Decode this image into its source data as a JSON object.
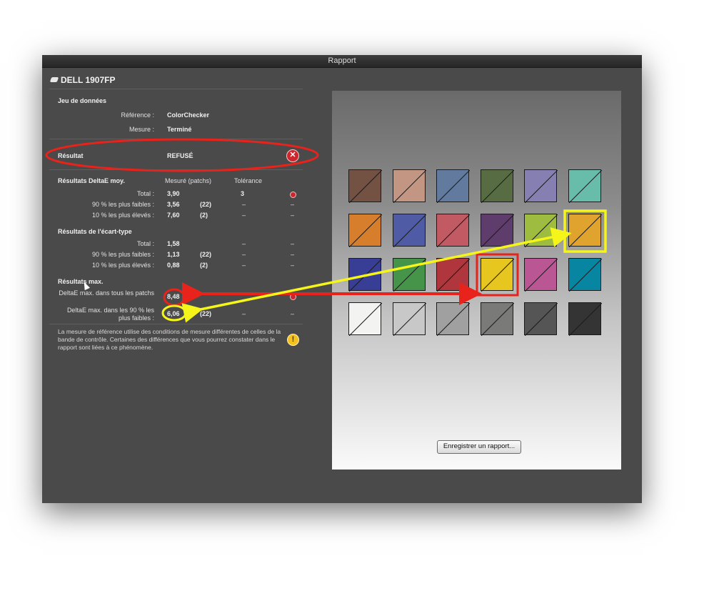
{
  "window": {
    "title": "Rapport"
  },
  "device": {
    "name": "DELL 1907FP"
  },
  "dataset": {
    "heading": "Jeu de données",
    "reference_label": "Référence :",
    "reference_value": "ColorChecker",
    "measure_label": "Mesure :",
    "measure_value": "Terminé"
  },
  "result": {
    "label": "Résultat",
    "value": "REFUSÉ"
  },
  "deltae_avg": {
    "heading": "Résultats DeltaE moy.",
    "col_measured": "Mesuré (patchs)",
    "col_tolerance": "Tolérance",
    "rows": [
      {
        "label": "Total :",
        "value": "3,90",
        "patches": "",
        "tolerance": "3",
        "status": "fail"
      },
      {
        "label": "90 % les plus faibles :",
        "value": "3,56",
        "patches": "(22)",
        "tolerance": "–",
        "status": "–"
      },
      {
        "label": "10 % les plus élevés :",
        "value": "7,60",
        "patches": "(2)",
        "tolerance": "–",
        "status": "–"
      }
    ]
  },
  "stddev": {
    "heading": "Résultats de l'écart-type",
    "rows": [
      {
        "label": "Total :",
        "value": "1,58",
        "patches": "",
        "tolerance": "–",
        "status": "–"
      },
      {
        "label": "90 % les plus faibles :",
        "value": "1,13",
        "patches": "(22)",
        "tolerance": "–",
        "status": "–"
      },
      {
        "label": "10 % les plus élevés :",
        "value": "0,88",
        "patches": "(2)",
        "tolerance": "–",
        "status": "–"
      }
    ]
  },
  "max": {
    "heading": "Résultats max.",
    "row1_label": "DeltaE max. dans tous les patchs",
    "row1_value": "8,48",
    "row2_label_line1": "DeltaE max. dans les 90 % les",
    "row2_label_line2": "plus faibles :",
    "row2_value": "6,06",
    "row2_patches": "(22)",
    "row2_tolerance": "–",
    "row2_status": "–"
  },
  "note": "La mesure de référence utilise des conditions de mesure différentes de celles de la bande de contrôle. Certaines des différences que vous pourrez constater dans le rapport sont liées à ce phénomène.",
  "save_button": "Enregistrer un rapport...",
  "patches": [
    [
      "#735244",
      "#c29682",
      "#627a9d",
      "#576c43",
      "#8580b1",
      "#67bdaa"
    ],
    [
      "#d67e2c",
      "#505ba6",
      "#c15a63",
      "#5e3c6c",
      "#9dbc40",
      "#e0a32e"
    ],
    [
      "#383d96",
      "#469449",
      "#af363c",
      "#e7c71f",
      "#bb5695",
      "#0885a1"
    ],
    [
      "#f3f3f2",
      "#c8c8c8",
      "#a0a0a0",
      "#7a7a79",
      "#555555",
      "#343434"
    ]
  ],
  "highlights": {
    "red_patch": "row 3, col 4",
    "yellow_patch": "row 2, col 6"
  },
  "colors": {
    "window_bg": "#4a4a4a",
    "annotation_red": "#e8231b",
    "annotation_yellow": "#f5f51a"
  }
}
